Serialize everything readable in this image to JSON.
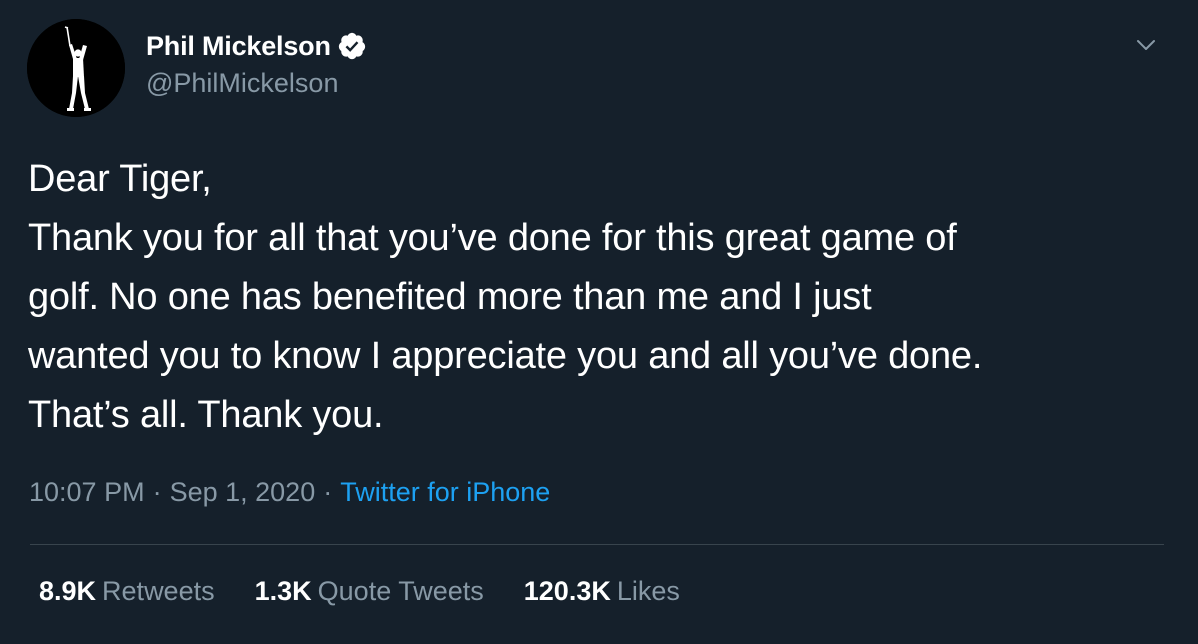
{
  "author": {
    "display_name": "Phil Mickelson",
    "handle": "@PhilMickelson",
    "verified": true,
    "avatar_icon": "golfer-silhouette-icon",
    "verified_icon": "verified-badge-icon"
  },
  "menu": {
    "icon": "chevron-down-icon"
  },
  "tweet": {
    "lines": [
      "Dear Tiger,",
      "Thank you for all that you’ve done for this great game of",
      "golf. No one has benefited more than me and I just",
      "wanted you to know I appreciate you and all you’ve done.",
      "That’s all. Thank you."
    ]
  },
  "meta": {
    "time": "10:07 PM",
    "separator": "·",
    "date": "Sep 1, 2020",
    "source": "Twitter for iPhone"
  },
  "stats": {
    "retweets_count": "8.9K",
    "retweets_label": "Retweets",
    "quotes_count": "1.3K",
    "quotes_label": "Quote Tweets",
    "likes_count": "120.3K",
    "likes_label": "Likes"
  },
  "colors": {
    "background": "#15202b",
    "text_primary": "#ffffff",
    "text_secondary": "#8899a6",
    "link": "#1da1f2",
    "divider": "#38444d"
  }
}
